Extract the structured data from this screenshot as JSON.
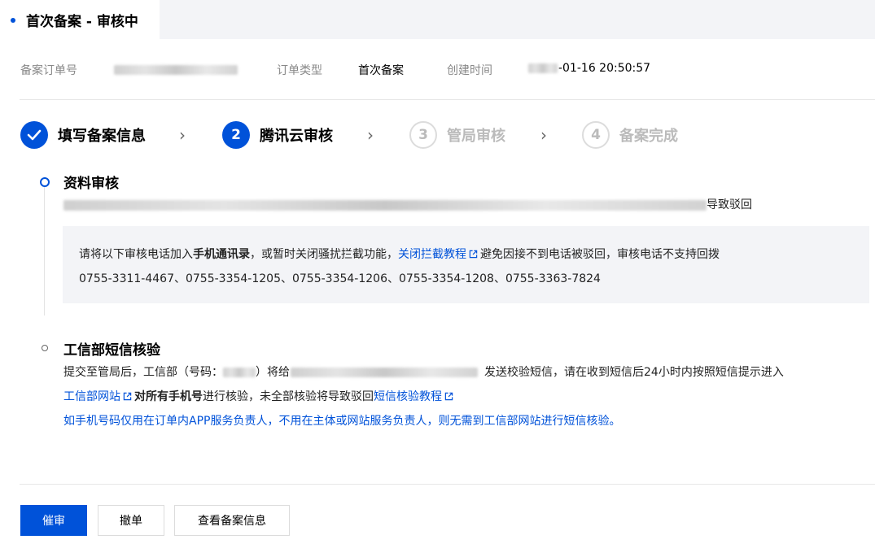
{
  "tab": {
    "title": "首次备案 - 审核中"
  },
  "meta": {
    "order_no_label": "备案订单号",
    "order_type_label": "订单类型",
    "order_type_value": "首次备案",
    "created_label": "创建时间",
    "created_value": "-01-16 20:50:57"
  },
  "steps": [
    {
      "label": "填写备案信息",
      "number": "1",
      "state": "done"
    },
    {
      "label": "腾讯云审核",
      "number": "2",
      "state": "active"
    },
    {
      "label": "管局审核",
      "number": "3",
      "state": "todo"
    },
    {
      "label": "备案完成",
      "number": "4",
      "state": "todo"
    }
  ],
  "review": {
    "title": "资料审核",
    "reason_suffix": "导致驳回",
    "notice": {
      "line1_prefix": "请将以下审核电话加入",
      "line1_bold": "手机通讯录",
      "line1_mid": "，或暂时关闭骚扰拦截功能，",
      "line1_link": "关闭拦截教程",
      "line1_suffix": "避免因接不到电话被驳回，审核电话不支持回拨",
      "phones": "0755-3311-4467、0755-3354-1205、0755-3354-1206、0755-3354-1208、0755-3363-7824"
    }
  },
  "sms": {
    "title": "工信部短信核验",
    "line1_a": "提交至管局后，工信部（号码：",
    "line1_b": "）将给",
    "line1_c": "发送校验短信，请在收到短信后24小时内按照短信提示进入",
    "line2_link1": "工信部网站",
    "line2_bold": "对所有手机号",
    "line2_mid": "进行核验，未全部核验将导致驳回",
    "line2_link2": "短信核验教程",
    "line3": "如手机号码仅用在订单内APP服务负责人，不用在主体或网站服务负责人，则无需到工信部网站进行短信核验。"
  },
  "buttons": {
    "urge": "催审",
    "cancel": "撤单",
    "view": "查看备案信息"
  },
  "colors": {
    "primary": "#0052d9",
    "muted": "#bbbbbb",
    "notice_bg": "#f3f4f7"
  }
}
